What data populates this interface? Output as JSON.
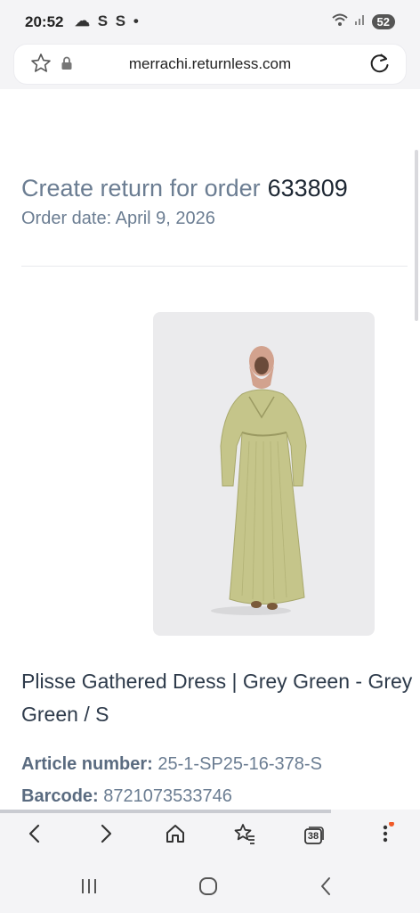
{
  "status_bar": {
    "time": "20:52",
    "left_icons": "☁ S S •",
    "battery": "52"
  },
  "browser": {
    "url": "merrachi.returnless.com"
  },
  "order": {
    "title": "Create return for order",
    "number": "633809",
    "date": "Order date: April 9, 2026"
  },
  "product": {
    "name": "Plisse Gathered Dress | Grey Green - Grey Green / S",
    "article_label": "Article number:",
    "article_value": "25-1-SP25-16-378-S",
    "barcode_label": "Barcode:",
    "barcode_value": "8721073533746"
  },
  "bottom_nav": {
    "tabs_count": "38"
  },
  "colors": {
    "accent": "#6b7d92",
    "dress": "#c5c58a",
    "hijab": "#d2a28e",
    "notification_dot": "#f05a28"
  }
}
